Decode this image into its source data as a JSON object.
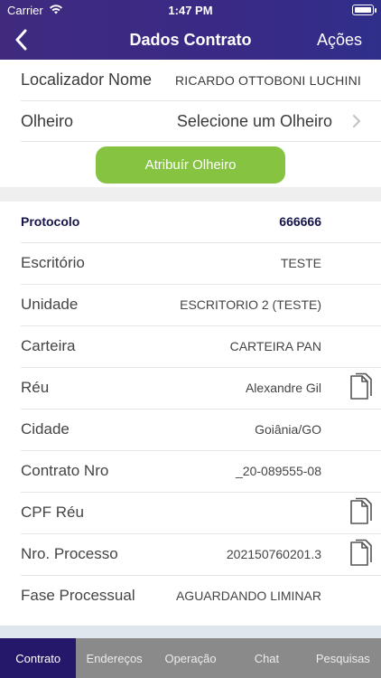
{
  "status_bar": {
    "carrier": "Carrier",
    "time": "1:47 PM",
    "wifi_icon": "wifi-icon",
    "battery_icon": "battery-icon"
  },
  "nav": {
    "back_icon": "chevron-left-icon",
    "title": "Dados Contrato",
    "actions_label": "Ações"
  },
  "header_rows": {
    "localizador": {
      "label": "Localizador Nome",
      "value": "RICARDO OTTOBONI LUCHINI"
    },
    "olheiro": {
      "label": "Olheiro",
      "value": "Selecione um Olheiro",
      "icon": "chevron-right-icon"
    }
  },
  "assign_button": {
    "label": "Atribuír Olheiro"
  },
  "details": [
    {
      "label": "Protocolo",
      "value": "666666",
      "bold": true,
      "copy": false
    },
    {
      "label": "Escritório",
      "value": "TESTE",
      "bold": false,
      "copy": false
    },
    {
      "label": "Unidade",
      "value": "ESCRITORIO 2 (TESTE)",
      "bold": false,
      "copy": false
    },
    {
      "label": "Carteira",
      "value": "CARTEIRA PAN",
      "bold": false,
      "copy": false
    },
    {
      "label": "Réu",
      "value": "Alexandre Gil",
      "bold": false,
      "copy": true
    },
    {
      "label": "Cidade",
      "value": "Goiânia/GO",
      "bold": false,
      "copy": false
    },
    {
      "label": "Contrato Nro",
      "value": "_20-089555-08",
      "bold": false,
      "copy": false
    },
    {
      "label": "CPF Réu",
      "value": "",
      "bold": false,
      "copy": true
    },
    {
      "label": "Nro. Processo",
      "value": "202150760201.3",
      "bold": false,
      "copy": true
    },
    {
      "label": "Fase Processual",
      "value": "AGUARDANDO LIMINAR",
      "bold": false,
      "copy": false
    }
  ],
  "tabs": [
    {
      "label": "Contrato",
      "active": true
    },
    {
      "label": "Endereços",
      "active": false
    },
    {
      "label": "Operação",
      "active": false
    },
    {
      "label": "Chat",
      "active": false
    },
    {
      "label": "Pesquisas",
      "active": false
    }
  ],
  "colors": {
    "header": "#3a2a86",
    "accent_button": "#85c341",
    "tab_active": "#25186a",
    "tab_inactive": "#8a8a8a",
    "emphasis_text": "#15154a"
  }
}
